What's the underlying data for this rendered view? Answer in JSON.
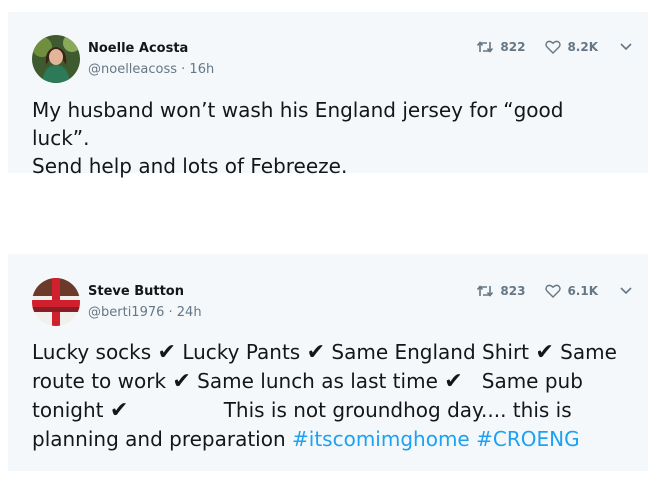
{
  "tweets": [
    {
      "author_name": "Noelle Acosta",
      "handle_time": "@noelleacoss · 16h",
      "retweets": "822",
      "likes": "8.2K",
      "text_lines": [
        "My husband won’t wash his England jersey for “good luck”.",
        "Send help and lots of Febreeze."
      ]
    },
    {
      "author_name": "Steve Button",
      "handle_time": "@berti1976 · 24h",
      "retweets": "823",
      "likes": "6.1K",
      "segments": {
        "s1": "Lucky socks ",
        "check": "✔",
        "s2": " Lucky Pants ",
        "s3": " Same England Shirt ",
        "s4": " Same route to work ",
        "s5": " Same lunch as last time ",
        "s6": "   Same pub tonight ",
        "s7": "               This is not groundhog day.... this is planning and preparation ",
        "hashtag1": "#itscomimghome",
        "hashtag2": "#CROENG"
      }
    }
  ],
  "icons": {
    "retweet": "retweet-icon",
    "like": "heart-icon",
    "more": "chevron-down-icon"
  },
  "colors": {
    "card_bg": "#f5f8fa",
    "text": "#14171a",
    "secondary": "#657786",
    "link": "#1da1f2"
  }
}
